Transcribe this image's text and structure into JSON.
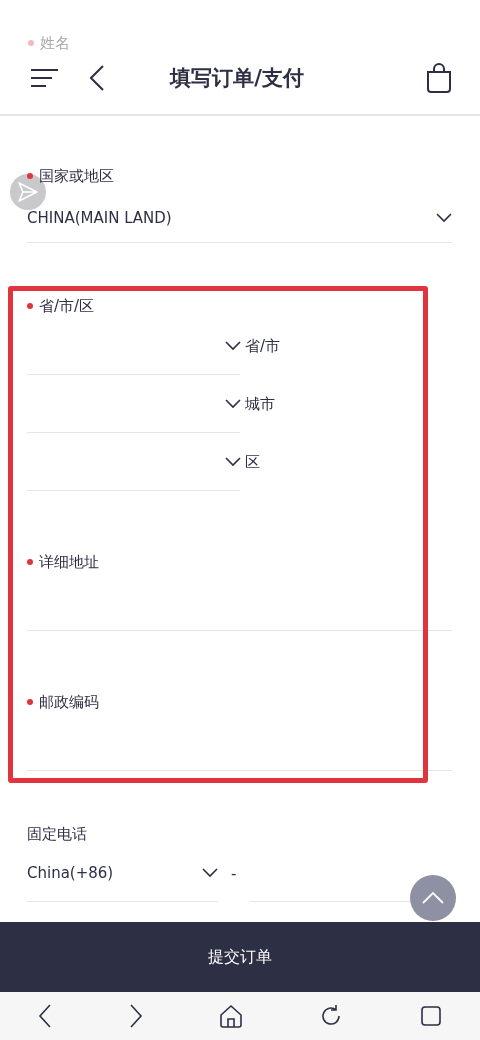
{
  "header": {
    "ghost_label": "姓名",
    "title": "填写订单/支付"
  },
  "form": [
    {
      "kind": "select",
      "label": "国家或地区",
      "required": true,
      "highlighted": false,
      "value": "CHINA(MAIN LAND)"
    },
    {
      "kind": "region",
      "label": "省/市/区",
      "required": true,
      "highlighted": true,
      "selects": [
        {
          "caption": "省/市"
        },
        {
          "caption": "城市"
        },
        {
          "caption": "区"
        }
      ]
    },
    {
      "kind": "text",
      "label": "详细地址",
      "required": true,
      "highlighted": true
    },
    {
      "kind": "text",
      "label": "邮政编码",
      "required": true,
      "highlighted": true
    },
    {
      "kind": "phone",
      "label": "固定电话",
      "required": false,
      "highlighted": false,
      "code": "China(+86)",
      "separator": "-"
    }
  ],
  "submit": "提交订单"
}
